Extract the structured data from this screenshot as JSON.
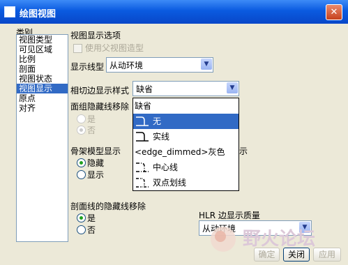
{
  "window": {
    "title": "绘图视图",
    "close_glyph": "✕"
  },
  "categories": {
    "header": "类别",
    "items": [
      "视图类型",
      "可见区域",
      "比例",
      "剖面",
      "视图状态",
      "视图显示",
      "原点",
      "对齐"
    ],
    "selected_index": 5
  },
  "display_options": {
    "group_label": "视图显示选项",
    "use_parent_style": "使用父视图造型",
    "line_style_label": "显示线型",
    "line_style_value": "从动环境",
    "tangent_label": "相切边显示样式",
    "tangent_value": "缺省"
  },
  "tangent_dropdown": {
    "items": [
      {
        "label": "缺省",
        "icon": "none"
      },
      {
        "label": "无",
        "icon": "hook-icon"
      },
      {
        "label": "实线",
        "icon": "solid-line-icon"
      },
      {
        "label": "<edge_dimmed>灰色",
        "icon": "none"
      },
      {
        "label": "中心线",
        "icon": "centerline-icon"
      },
      {
        "label": "双点划线",
        "icon": "phantom-line-icon"
      }
    ],
    "highlighted_index": 1
  },
  "hidden_line_removal": {
    "label": "面组隐藏线移除",
    "yes": "是",
    "no": "否"
  },
  "skeleton": {
    "label": "骨架模型显示",
    "hide": "隐藏",
    "show": "显示",
    "clipped_text": "示"
  },
  "section_hidden": {
    "label": "剖面线的隐藏线移除",
    "yes": "是",
    "no": "否"
  },
  "hlr": {
    "label": "HLR 边显示质量",
    "value": "从动环境"
  },
  "buttons": {
    "ok": "确定",
    "close": "关闭",
    "apply": "应用"
  },
  "watermark": {
    "text": "野火论坛"
  },
  "colors": {
    "title_blue": "#0a5ae0",
    "selection": "#316ac5",
    "radio_green": "#21a121"
  }
}
